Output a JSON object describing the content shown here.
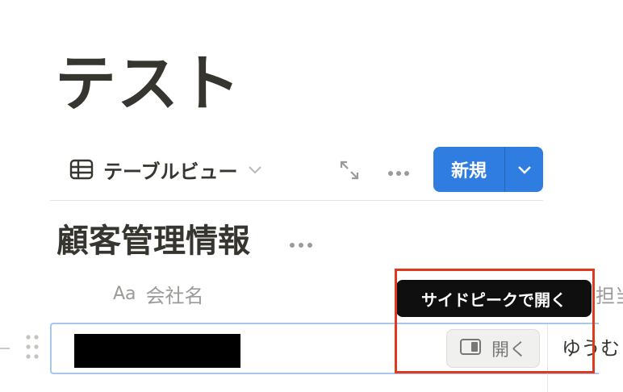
{
  "page": {
    "title": "テスト"
  },
  "toolbar": {
    "view_label": "テーブルビュー",
    "new_label": "新規"
  },
  "database": {
    "title": "顧客管理情報"
  },
  "table": {
    "columns": [
      {
        "icon": "Aa",
        "label": "会社名"
      },
      {
        "label": "担当"
      }
    ],
    "rows": [
      {
        "company": "",
        "person": "ゆうむ"
      }
    ]
  },
  "row_actions": {
    "open_label": "開く"
  },
  "tooltip": {
    "text": "サイドピークで開く"
  },
  "colors": {
    "accent": "#2f7de1",
    "highlight": "#e03a1e",
    "text": "#37352f",
    "muted": "#9b9a97"
  },
  "icons": [
    "table-icon",
    "chevron-down-icon",
    "expand-icon",
    "more-icon",
    "drag-handle-icon",
    "side-peek-icon"
  ]
}
